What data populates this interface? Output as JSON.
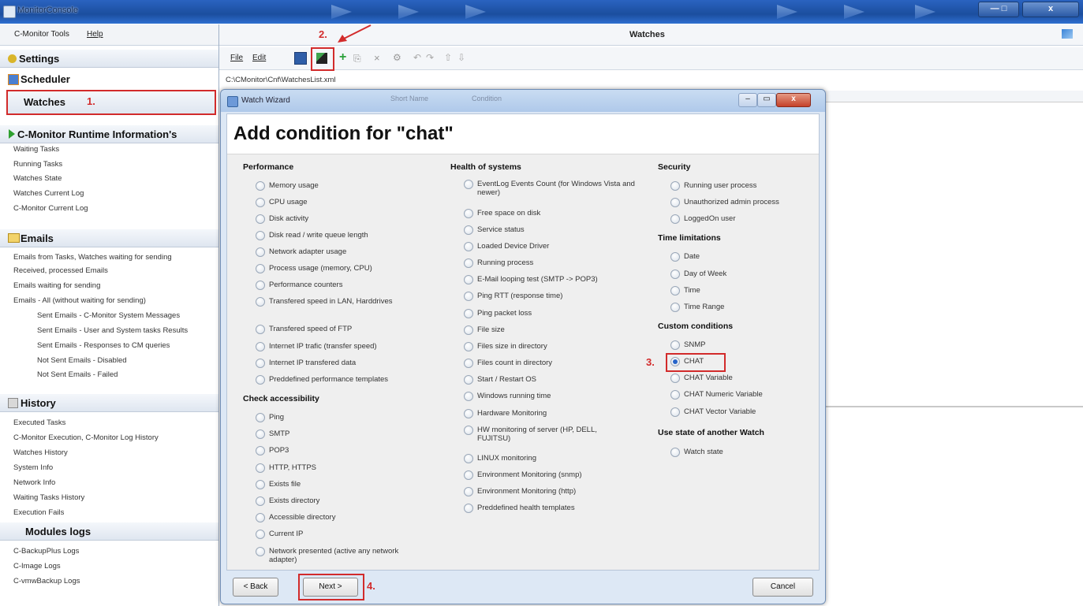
{
  "app": {
    "title": "MonitorConsole"
  },
  "menu": {
    "items": [
      "C-Monitor Tools",
      "Help"
    ]
  },
  "nav": {
    "settings": "Settings",
    "scheduler": "Scheduler",
    "watches": "Watches",
    "runtime": {
      "title": "C-Monitor Runtime Information's",
      "items": [
        "Waiting Tasks",
        "Running Tasks",
        "Watches State",
        "Watches Current Log",
        "C-Monitor Current Log"
      ]
    },
    "emails": {
      "title": "Emails",
      "items": [
        "Emails from Tasks, Watches waiting for sending",
        "Received, processed Emails",
        "Emails waiting for sending",
        "Emails - All (without waiting for sending)",
        "Sent Emails - C-Monitor System Messages",
        "Sent Emails - User and System tasks Results",
        "Sent Emails - Responses to CM queries",
        "Not Sent Emails - Disabled",
        "Not Sent Emails - Failed"
      ]
    },
    "history": {
      "title": "History",
      "items": [
        "Executed Tasks",
        "C-Monitor Execution, C-Monitor Log History",
        "Watches History",
        "System Info",
        "Network Info",
        "Waiting Tasks History",
        "Execution Fails"
      ]
    },
    "modules": {
      "title": "Modules logs",
      "items": [
        "C-BackupPlus Logs",
        "C-Image Logs",
        "C-vmwBackup Logs"
      ]
    }
  },
  "main": {
    "title": "Watches",
    "file_menu": "File",
    "edit_menu": "Edit",
    "path": "C:\\CMonitor\\Cnf\\WatchesList.xml",
    "columns": [
      "Short Name",
      "Condition"
    ]
  },
  "annotations": {
    "step1": "1.",
    "step2": "2.",
    "step3": "3.",
    "step4": "4."
  },
  "dialog": {
    "title": "Watch Wizard",
    "heading": "Add condition for \"chat\"",
    "columns": [
      {
        "groups": [
          {
            "title": "Performance",
            "options": [
              "Memory usage",
              "CPU usage",
              "Disk activity",
              "Disk read / write queue length",
              "Network adapter usage",
              "Process usage (memory, CPU)",
              "Performance counters",
              "Transfered speed in LAN, Harddrives",
              "Transfered speed of FTP",
              "Internet IP trafic (transfer speed)",
              "Internet IP transfered data",
              "Preddefined performance templates"
            ]
          },
          {
            "title": "Check accessibility",
            "options": [
              "Ping",
              "SMTP",
              "POP3",
              "HTTP, HTTPS",
              "Exists file",
              "Exists directory",
              "Accessible directory",
              "Current IP",
              "Network presented (active any network adapter)"
            ]
          }
        ]
      },
      {
        "groups": [
          {
            "title": "Health of systems",
            "options": [
              "EventLog Events Count (for Windows Vista and newer)",
              "Free space on disk",
              "Service status",
              "Loaded Device Driver",
              "Running process",
              "E-Mail looping test (SMTP -> POP3)",
              "Ping RTT (response time)",
              "Ping packet loss",
              "File size",
              "Files size in directory",
              "Files count in directory",
              "Start / Restart OS",
              "Windows running time",
              "Hardware Monitoring",
              "HW monitoring of server (HP, DELL, FUJITSU)",
              "LINUX monitoring",
              "Environment Monitoring (snmp)",
              "Environment Monitoring (http)",
              "Preddefined health templates"
            ]
          }
        ]
      },
      {
        "groups": [
          {
            "title": "Security",
            "options": [
              "Running user process",
              "Unauthorized admin process",
              "LoggedOn user"
            ]
          },
          {
            "title": "Time limitations",
            "options": [
              "Date",
              "Day of Week",
              "Time",
              "Time Range"
            ]
          },
          {
            "title": "Custom conditions",
            "options": [
              "SNMP",
              "CHAT",
              "CHAT Variable",
              "CHAT Numeric Variable",
              "CHAT Vector Variable"
            ]
          },
          {
            "title": "Use state of another Watch",
            "options": [
              "Watch state"
            ]
          }
        ]
      }
    ],
    "selected": "CHAT",
    "buttons": {
      "back": "< Back",
      "next": "Next >",
      "cancel": "Cancel"
    }
  },
  "colors": {
    "accent_red": "#d22b2b",
    "titlebar_blue": "#1b4e9e"
  }
}
